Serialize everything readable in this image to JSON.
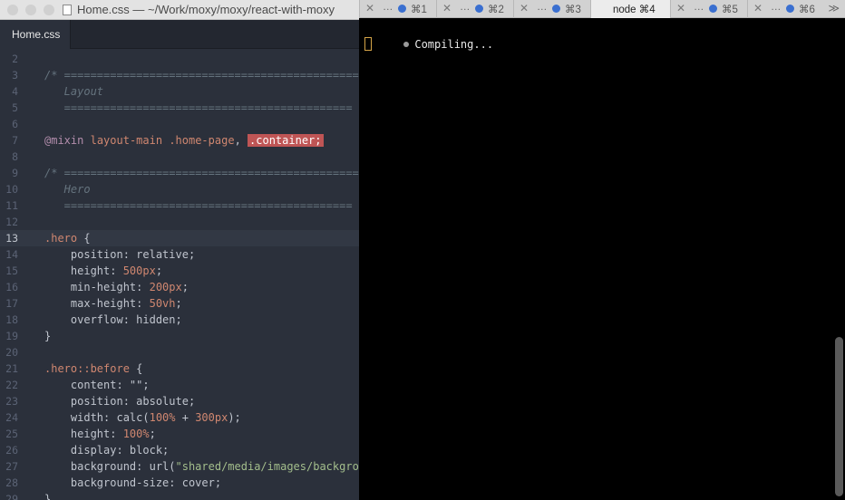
{
  "editor": {
    "window_title": "Home.css — ~/Work/moxy/moxy/react-with-moxy",
    "tab_label": "Home.css",
    "lines": [
      {
        "n": "2",
        "html": ""
      },
      {
        "n": "3",
        "html": "<span class='cm'>/* ===============================================</span>"
      },
      {
        "n": "4",
        "html": "<span class='cm'>   Layout</span>"
      },
      {
        "n": "5",
        "html": "<span class='cm'>   ============================================</span>"
      },
      {
        "n": "6",
        "html": ""
      },
      {
        "n": "7",
        "html": "<span class='at'>@mixin</span> <span class='sel'>layout-main</span> <span class='sel'>.home-page</span>, <span class='hl'>.container;</span>"
      },
      {
        "n": "8",
        "html": ""
      },
      {
        "n": "9",
        "html": "<span class='cm'>/* ===============================================</span>"
      },
      {
        "n": "10",
        "html": "<span class='cm'>   Hero</span>"
      },
      {
        "n": "11",
        "html": "<span class='cm'>   ============================================</span>"
      },
      {
        "n": "12",
        "html": ""
      },
      {
        "n": "13",
        "html": "<span class='sel'>.hero</span> {",
        "active": true
      },
      {
        "n": "14",
        "html": "    position: relative;"
      },
      {
        "n": "15",
        "html": "    height: <span class='num'>500px</span>;"
      },
      {
        "n": "16",
        "html": "    min-height: <span class='num'>200px</span>;"
      },
      {
        "n": "17",
        "html": "    max-height: <span class='num'>50vh</span>;"
      },
      {
        "n": "18",
        "html": "    overflow: hidden;"
      },
      {
        "n": "19",
        "html": "}"
      },
      {
        "n": "20",
        "html": ""
      },
      {
        "n": "21",
        "html": "<span class='sel'>.hero::before</span> {"
      },
      {
        "n": "22",
        "html": "    content: \"\";"
      },
      {
        "n": "23",
        "html": "    position: absolute;"
      },
      {
        "n": "24",
        "html": "    width: calc(<span class='num'>100%</span> + <span class='num'>300px</span>);"
      },
      {
        "n": "25",
        "html": "    height: <span class='num'>100%</span>;"
      },
      {
        "n": "26",
        "html": "    display: block;"
      },
      {
        "n": "27",
        "html": "    background: url(<span class='str'>\"shared/media/images/backgro</span>"
      },
      {
        "n": "28",
        "html": "    background-size: cover;"
      },
      {
        "n": "29",
        "html": "}"
      }
    ]
  },
  "terminal": {
    "tabs": [
      {
        "label": "⌘1",
        "active": false
      },
      {
        "label": "⌘2",
        "active": false
      },
      {
        "label": "⌘3",
        "active": false
      },
      {
        "label": "node ⌘4",
        "active": true
      },
      {
        "label": "⌘5",
        "active": false
      },
      {
        "label": "⌘6",
        "active": false
      }
    ],
    "more_tabs": "≫",
    "output_line": "Compiling..."
  },
  "colors": {
    "editor_bg": "#2b303b",
    "terminal_bg": "#000000",
    "highlight": "#bf5555",
    "cursor": "#d6a548"
  }
}
